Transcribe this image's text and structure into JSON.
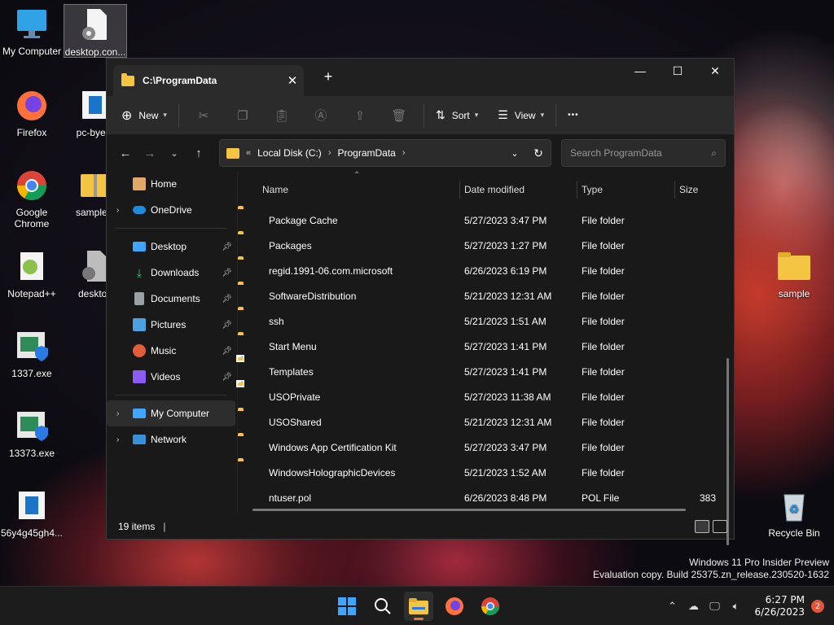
{
  "desktop": {
    "icons": [
      {
        "label": "My Computer"
      },
      {
        "label": "desktop.con..."
      },
      {
        "label": "Firefox"
      },
      {
        "label": "pc-bye-b"
      },
      {
        "label": "Google Chrome"
      },
      {
        "label": "sample.c"
      },
      {
        "label": "Notepad++"
      },
      {
        "label": "desktop"
      },
      {
        "label": "1337.exe"
      },
      {
        "label": "13373.exe"
      },
      {
        "label": "56y4g45gh4..."
      },
      {
        "label": "sample"
      },
      {
        "label": "Recycle Bin"
      }
    ],
    "watermark_line1": "Windows 11 Pro Insider Preview",
    "watermark_line2": "Evaluation copy. Build 25375.zn_release.230520-1632"
  },
  "window": {
    "tab_title": "C:\\ProgramData",
    "tab_close": "✕",
    "new_tab": "+",
    "controls": {
      "minimize": "—",
      "maximize": "☐",
      "close": "✕"
    },
    "toolbar": {
      "new_label": "New",
      "sort_label": "Sort",
      "view_label": "View",
      "more_label": "•••"
    },
    "address": {
      "overflow": "«",
      "crumbs": [
        "Local Disk (C:)",
        "ProgramData"
      ],
      "sep": "›"
    },
    "search": {
      "placeholder": "Search ProgramData"
    },
    "sidebar": [
      {
        "label": "Home"
      },
      {
        "label": "OneDrive"
      },
      {
        "label": "Desktop"
      },
      {
        "label": "Downloads"
      },
      {
        "label": "Documents"
      },
      {
        "label": "Pictures"
      },
      {
        "label": "Music"
      },
      {
        "label": "Videos"
      },
      {
        "label": "My Computer"
      },
      {
        "label": "Network"
      }
    ],
    "columns": {
      "name": "Name",
      "date": "Date modified",
      "type": "Type",
      "size": "Size"
    },
    "rows": [
      {
        "name": "Package Cache",
        "date": "5/27/2023 3:47 PM",
        "type": "File folder",
        "size": ""
      },
      {
        "name": "Packages",
        "date": "5/27/2023 1:27 PM",
        "type": "File folder",
        "size": ""
      },
      {
        "name": "regid.1991-06.com.microsoft",
        "date": "6/26/2023 6:19 PM",
        "type": "File folder",
        "size": ""
      },
      {
        "name": "SoftwareDistribution",
        "date": "5/21/2023 12:31 AM",
        "type": "File folder",
        "size": ""
      },
      {
        "name": "ssh",
        "date": "5/21/2023 1:51 AM",
        "type": "File folder",
        "size": ""
      },
      {
        "name": "Start Menu",
        "date": "5/27/2023 1:41 PM",
        "type": "File folder",
        "size": ""
      },
      {
        "name": "Templates",
        "date": "5/27/2023 1:41 PM",
        "type": "File folder",
        "size": ""
      },
      {
        "name": "USOPrivate",
        "date": "5/27/2023 11:38 AM",
        "type": "File folder",
        "size": ""
      },
      {
        "name": "USOShared",
        "date": "5/21/2023 12:31 AM",
        "type": "File folder",
        "size": ""
      },
      {
        "name": "Windows App Certification Kit",
        "date": "5/27/2023 3:47 PM",
        "type": "File folder",
        "size": ""
      },
      {
        "name": "WindowsHolographicDevices",
        "date": "5/21/2023 1:52 AM",
        "type": "File folder",
        "size": ""
      },
      {
        "name": "ntuser.pol",
        "date": "6/26/2023 8:48 PM",
        "type": "POL File",
        "size": "383"
      }
    ],
    "status": {
      "count": "19 items"
    }
  },
  "taskbar": {
    "time": "6:27 PM",
    "date": "6/26/2023",
    "notifications": "2"
  }
}
